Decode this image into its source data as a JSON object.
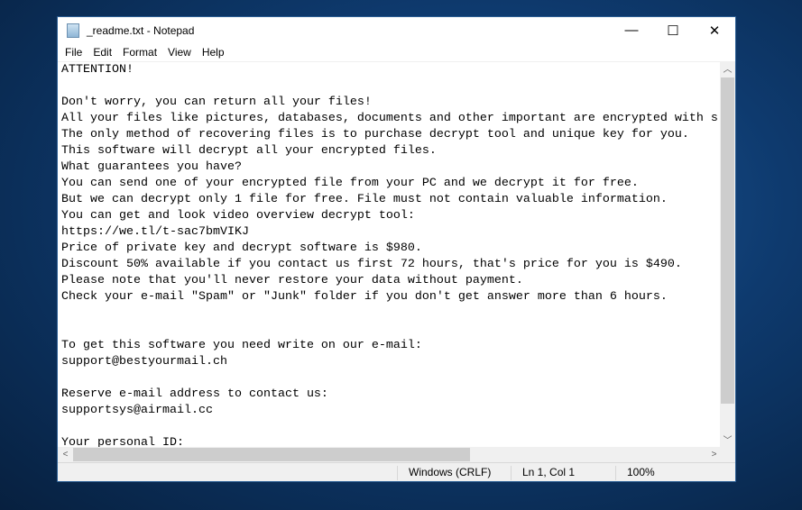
{
  "window": {
    "title": "_readme.txt - Notepad",
    "minimize": "—",
    "maximize": "☐",
    "close": "✕"
  },
  "menu": [
    "File",
    "Edit",
    "Format",
    "View",
    "Help"
  ],
  "content": "ATTENTION!\n\nDon't worry, you can return all your files!\nAll your files like pictures, databases, documents and other important are encrypted with s\nThe only method of recovering files is to purchase decrypt tool and unique key for you.\nThis software will decrypt all your encrypted files.\nWhat guarantees you have?\nYou can send one of your encrypted file from your PC and we decrypt it for free.\nBut we can decrypt only 1 file for free. File must not contain valuable information.\nYou can get and look video overview decrypt tool:\nhttps://we.tl/t-sac7bmVIKJ\nPrice of private key and decrypt software is $980.\nDiscount 50% available if you contact us first 72 hours, that's price for you is $490.\nPlease note that you'll never restore your data without payment.\nCheck your e-mail \"Spam\" or \"Junk\" folder if you don't get answer more than 6 hours.\n\n\nTo get this software you need write on our e-mail:\nsupport@bestyourmail.ch\n\nReserve e-mail address to contact us:\nsupportsys@airmail.cc\n\nYour personal ID:",
  "status": {
    "line_ending": "Windows (CRLF)",
    "position": "Ln 1, Col 1",
    "zoom": "100%"
  }
}
